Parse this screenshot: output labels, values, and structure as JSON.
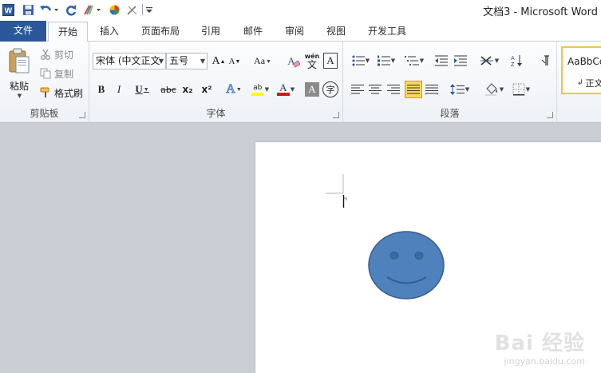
{
  "window": {
    "title": "文档3 - Microsoft Word"
  },
  "tabs": {
    "file": "文件",
    "home": "开始",
    "insert": "插入",
    "layout": "页面布局",
    "references": "引用",
    "mailings": "邮件",
    "review": "审阅",
    "view": "视图",
    "developer": "开发工具"
  },
  "clipboard": {
    "label": "剪贴板",
    "paste": "粘贴",
    "cut": "剪切",
    "copy": "复制",
    "format_painter": "格式刷"
  },
  "font": {
    "label": "字体",
    "font_name": "宋体 (中文正文",
    "font_size": "五号",
    "change_case": "Aa",
    "bold": "B",
    "italic": "I",
    "underline": "U",
    "strike": "abc",
    "subscript": "x₂",
    "superscript": "x²",
    "grow": "A",
    "shrink": "A",
    "clear": "A",
    "phonetic": "wén",
    "phonetic_char": "文",
    "border_char": "A",
    "shading_char": "A",
    "enclose_char": "字",
    "text_effect": "A",
    "highlight": "ab",
    "font_color": "A"
  },
  "paragraph": {
    "label": "段落"
  },
  "styles": {
    "preview": "AaBbCc",
    "normal": "正文"
  },
  "colors": {
    "accent": "#2b579a",
    "highlight": "#ffff00",
    "font_color": "#e01010",
    "smiley_fill": "#4f81bd",
    "smiley_stroke": "#385d8a"
  },
  "watermark": {
    "main": "Bai 经验",
    "sub": "jingyan.baidu.com"
  }
}
